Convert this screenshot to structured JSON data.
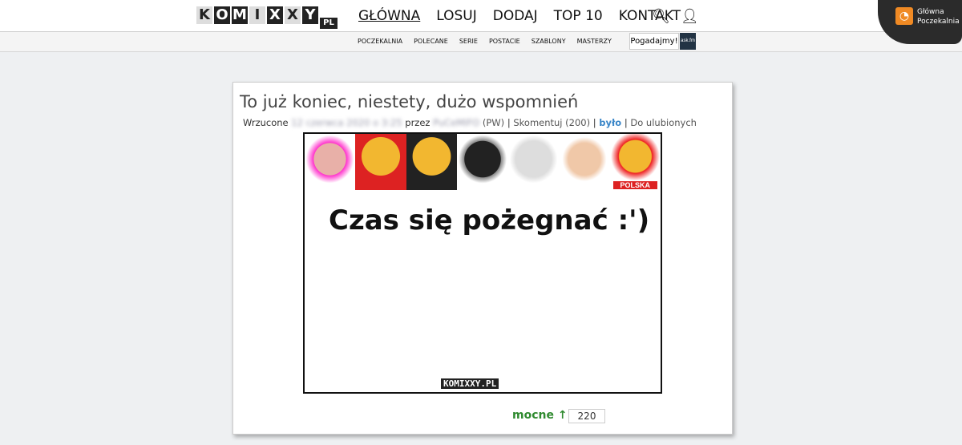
{
  "logo": {
    "letters": [
      "K",
      "O",
      "M",
      "I",
      "X",
      "X",
      "Y"
    ],
    "suffix": "PL"
  },
  "nav": [
    "GŁÓWNA",
    "LOSUJ",
    "DODAJ",
    "TOP 10",
    "KONTAKT"
  ],
  "subnav": [
    "Poczekalnia",
    "Polecane",
    "Serie",
    "Postacie",
    "Szablony",
    "Masterzy"
  ],
  "pogadajmy": "Pogadajmy!",
  "ask": "ask.fm",
  "corner": {
    "line1": "Główna",
    "line2": "Poczekalnia"
  },
  "post": {
    "title": "To już koniec, niestety, dużo wspomnień",
    "uploaded": "Wrzucone",
    "date": "12 czerwca 2020 o 3:25",
    "by": "przez",
    "author": "PuCeMIFO",
    "author_tag": "(PW)",
    "comment": "Skomentuj (200)",
    "bylo": "było",
    "fav": "Do ulubionych",
    "caption": "Czas się pożegnać :')",
    "flag_label": "POLSKA",
    "watermark": "KOMIXXY.PL",
    "vote_label": "mocne ↑",
    "votes": "220"
  },
  "colors": {
    "accent": "#3a86c8",
    "vote": "#2f8a2f",
    "rss": "#f08a24"
  }
}
